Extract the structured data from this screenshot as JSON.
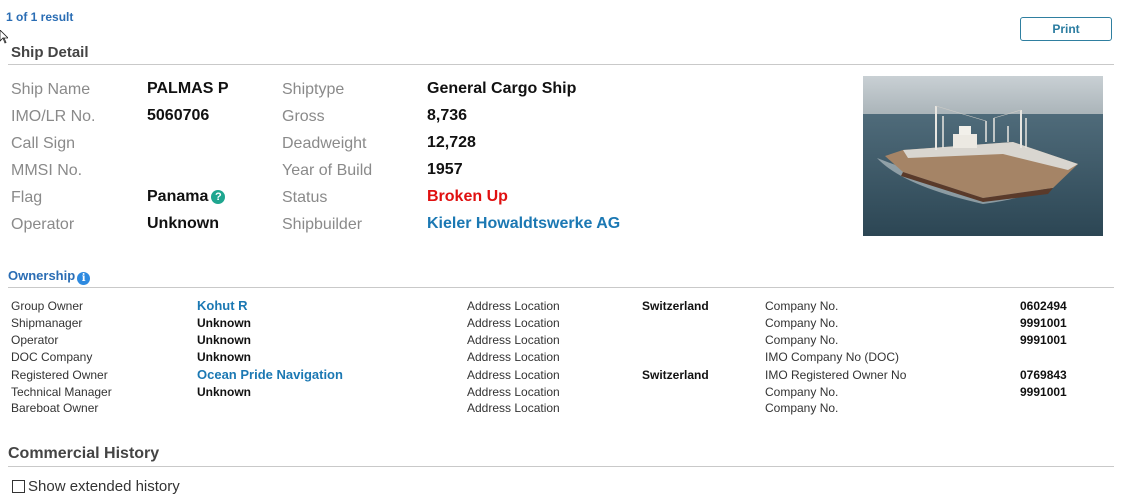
{
  "header": {
    "result_count": "1 of 1 result",
    "print_label": "Print"
  },
  "ship_detail": {
    "title": "Ship Detail",
    "left": [
      {
        "label": "Ship Name",
        "value": "PALMAS P"
      },
      {
        "label": "IMO/LR No.",
        "value": "5060706"
      },
      {
        "label": "Call Sign",
        "value": ""
      },
      {
        "label": "MMSI No.",
        "value": ""
      },
      {
        "label": "Flag",
        "value": "Panama"
      },
      {
        "label": "Operator",
        "value": "Unknown"
      }
    ],
    "right": [
      {
        "label": "Shiptype",
        "value": "General Cargo Ship"
      },
      {
        "label": "Gross",
        "value": "8,736"
      },
      {
        "label": "Deadweight",
        "value": "12,728"
      },
      {
        "label": "Year of Build",
        "value": "1957"
      },
      {
        "label": "Status",
        "value": "Broken Up"
      },
      {
        "label": "Shipbuilder",
        "value": "Kieler Howaldtswerke AG"
      }
    ],
    "flag_help_icon": "?",
    "status_color": "#e01010",
    "link_color": "#1b78b3"
  },
  "ownership": {
    "title": "Ownership",
    "info_icon": "i",
    "rows": [
      {
        "role": "Group Owner",
        "name": "Kohut R",
        "addr_label": "Address Location",
        "addr": "Switzerland",
        "co_label": "Company No.",
        "co_no": "0602494"
      },
      {
        "role": "Shipmanager",
        "name": "Unknown",
        "addr_label": "Address Location",
        "addr": "",
        "co_label": "Company No.",
        "co_no": "9991001"
      },
      {
        "role": "Operator",
        "name": "Unknown",
        "addr_label": "Address Location",
        "addr": "",
        "co_label": "Company No.",
        "co_no": "9991001"
      },
      {
        "role": "DOC Company",
        "name": "Unknown",
        "addr_label": "Address Location",
        "addr": "",
        "co_label": "IMO Company No (DOC)",
        "co_no": ""
      },
      {
        "role": "Registered Owner",
        "name": "Ocean Pride Navigation",
        "addr_label": "Address Location",
        "addr": "Switzerland",
        "co_label": "IMO Registered Owner No",
        "co_no": "0769843"
      },
      {
        "role": "Technical Manager",
        "name": "Unknown",
        "addr_label": "Address Location",
        "addr": "",
        "co_label": "Company No.",
        "co_no": "9991001"
      },
      {
        "role": "Bareboat Owner",
        "name": "",
        "addr_label": "Address Location",
        "addr": "",
        "co_label": "Company No.",
        "co_no": ""
      }
    ]
  },
  "commercial_history": {
    "title": "Commercial History",
    "show_extended_label": "Show extended history"
  }
}
